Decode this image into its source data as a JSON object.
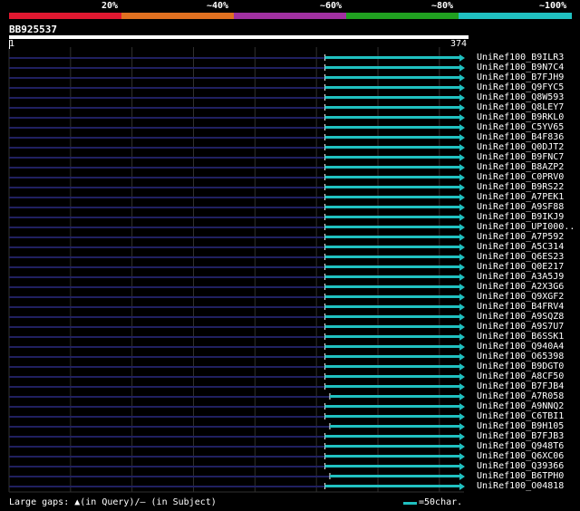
{
  "legend": {
    "labels": [
      "20%",
      "~40%",
      "~60%",
      "~80%",
      "~100%"
    ],
    "colors": [
      "#e01830",
      "#e07020",
      "#a030a0",
      "#20a020",
      "#20c0c0"
    ]
  },
  "query": {
    "id": "BB925537",
    "start": "1",
    "end": "374",
    "length": 374
  },
  "hits": [
    {
      "name": "UniRef100_B9ILR3",
      "start": 1,
      "end": 374,
      "qstart": 260
    },
    {
      "name": "UniRef100_B9N7C4",
      "start": 1,
      "end": 374,
      "qstart": 260
    },
    {
      "name": "UniRef100_B7FJH9",
      "start": 1,
      "end": 374,
      "qstart": 260
    },
    {
      "name": "UniRef100_Q9FYC5",
      "start": 1,
      "end": 374,
      "qstart": 260
    },
    {
      "name": "UniRef100_Q8W593",
      "start": 1,
      "end": 374,
      "qstart": 260
    },
    {
      "name": "UniRef100_Q8LEY7",
      "start": 1,
      "end": 374,
      "qstart": 260
    },
    {
      "name": "UniRef100_B9RKL0",
      "start": 1,
      "end": 374,
      "qstart": 260
    },
    {
      "name": "UniRef100_C5YV65",
      "start": 1,
      "end": 374,
      "qstart": 260
    },
    {
      "name": "UniRef100_B4F836",
      "start": 1,
      "end": 374,
      "qstart": 260
    },
    {
      "name": "UniRef100_Q0DJT2",
      "start": 1,
      "end": 374,
      "qstart": 260
    },
    {
      "name": "UniRef100_B9FNC7",
      "start": 1,
      "end": 374,
      "qstart": 260
    },
    {
      "name": "UniRef100_B8AZP2",
      "start": 1,
      "end": 374,
      "qstart": 260
    },
    {
      "name": "UniRef100_C0PRV0",
      "start": 1,
      "end": 374,
      "qstart": 260
    },
    {
      "name": "UniRef100_B9RS22",
      "start": 1,
      "end": 374,
      "qstart": 260
    },
    {
      "name": "UniRef100_A7PEK1",
      "start": 1,
      "end": 374,
      "qstart": 260
    },
    {
      "name": "UniRef100_A9SF88",
      "start": 1,
      "end": 374,
      "qstart": 260
    },
    {
      "name": "UniRef100_B9IKJ9",
      "start": 1,
      "end": 374,
      "qstart": 260
    },
    {
      "name": "UniRef100_UPI000..",
      "start": 1,
      "end": 374,
      "qstart": 260
    },
    {
      "name": "UniRef100_A7P592",
      "start": 1,
      "end": 374,
      "qstart": 260
    },
    {
      "name": "UniRef100_A5C314",
      "start": 1,
      "end": 374,
      "qstart": 260
    },
    {
      "name": "UniRef100_Q6ES23",
      "start": 1,
      "end": 374,
      "qstart": 260
    },
    {
      "name": "UniRef100_Q0E217",
      "start": 1,
      "end": 374,
      "qstart": 260
    },
    {
      "name": "UniRef100_A3A5J9",
      "start": 1,
      "end": 374,
      "qstart": 260
    },
    {
      "name": "UniRef100_A2X3G6",
      "start": 1,
      "end": 374,
      "qstart": 260
    },
    {
      "name": "UniRef100_Q9XGF2",
      "start": 1,
      "end": 374,
      "qstart": 260
    },
    {
      "name": "UniRef100_B4FRV4",
      "start": 1,
      "end": 374,
      "qstart": 260
    },
    {
      "name": "UniRef100_A9SQZ8",
      "start": 1,
      "end": 374,
      "qstart": 260
    },
    {
      "name": "UniRef100_A9S7U7",
      "start": 1,
      "end": 374,
      "qstart": 260
    },
    {
      "name": "UniRef100_B6SSK1",
      "start": 1,
      "end": 374,
      "qstart": 260
    },
    {
      "name": "UniRef100_Q940A4",
      "start": 1,
      "end": 374,
      "qstart": 260
    },
    {
      "name": "UniRef100_O65398",
      "start": 1,
      "end": 374,
      "qstart": 260
    },
    {
      "name": "UniRef100_B9DGT0",
      "start": 1,
      "end": 374,
      "qstart": 260
    },
    {
      "name": "UniRef100_A8CF50",
      "start": 1,
      "end": 374,
      "qstart": 260
    },
    {
      "name": "UniRef100_B7FJB4",
      "start": 1,
      "end": 374,
      "qstart": 260
    },
    {
      "name": "UniRef100_A7R058",
      "start": 1,
      "end": 374,
      "qstart": 264
    },
    {
      "name": "UniRef100_A9NNQ2",
      "start": 1,
      "end": 374,
      "qstart": 260
    },
    {
      "name": "UniRef100_C6TBI1",
      "start": 1,
      "end": 374,
      "qstart": 260
    },
    {
      "name": "UniRef100_B9H105",
      "start": 1,
      "end": 374,
      "qstart": 264
    },
    {
      "name": "UniRef100_B7FJB3",
      "start": 1,
      "end": 374,
      "qstart": 260
    },
    {
      "name": "UniRef100_Q948T6",
      "start": 1,
      "end": 374,
      "qstart": 260
    },
    {
      "name": "UniRef100_Q6XC06",
      "start": 1,
      "end": 374,
      "qstart": 260
    },
    {
      "name": "UniRef100_Q39366",
      "start": 1,
      "end": 374,
      "qstart": 260
    },
    {
      "name": "UniRef100_B6TPH0",
      "start": 1,
      "end": 374,
      "qstart": 264
    },
    {
      "name": "UniRef100_O04818",
      "start": 1,
      "end": 374,
      "qstart": 260
    }
  ],
  "colors": {
    "background": "#000000",
    "match": "#20c0c0",
    "unaligned": "#202060",
    "grid": "#303030",
    "axis": "#ffffff"
  },
  "footer": {
    "left_text": "Large gaps: ▲(in Query)/– (in Subject)",
    "right_text": "=50char."
  }
}
